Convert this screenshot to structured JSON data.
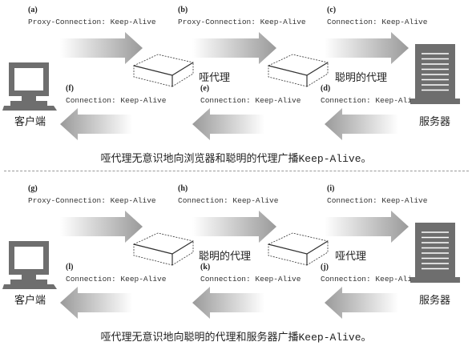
{
  "divider": "dashed",
  "colors": {
    "arrow_dark": "#9a9a9a",
    "arrow_light": "#ffffff",
    "device": "#6e6e6e"
  },
  "panels": [
    {
      "forward": [
        {
          "label": "(a)",
          "header": "Proxy-Connection: Keep-Alive"
        },
        {
          "label": "(b)",
          "header": "Proxy-Connection: Keep-Alive"
        },
        {
          "label": "(c)",
          "header": "Connection: Keep-Alive"
        }
      ],
      "backward": [
        {
          "label": "(f)",
          "header": "Connection: Keep-Alive"
        },
        {
          "label": "(e)",
          "header": "Connection: Keep-Alive"
        },
        {
          "label": "(d)",
          "header": "Connection: Keep-Alive"
        }
      ],
      "client": "客户端",
      "proxy1": "哑代理",
      "proxy2": "聪明的代理",
      "server": "服务器",
      "caption_pre": "哑代理无意识地向浏览器和聪明的代理广播",
      "caption_mono": "Keep-Alive",
      "caption_post": "。"
    },
    {
      "forward": [
        {
          "label": "(g)",
          "header": "Proxy-Connection: Keep-Alive"
        },
        {
          "label": "(h)",
          "header": "Connection: Keep-Alive"
        },
        {
          "label": "(i)",
          "header": "Connection: Keep-Alive"
        }
      ],
      "backward": [
        {
          "label": "(l)",
          "header": "Connection: Keep-Alive"
        },
        {
          "label": "(k)",
          "header": "Connection: Keep-Alive"
        },
        {
          "label": "(j)",
          "header": "Connection: Keep-Alive"
        }
      ],
      "client": "客户端",
      "proxy1": "聪明的代理",
      "proxy2": "哑代理",
      "server": "服务器",
      "caption_pre": "哑代理无意识地向聪明的代理和服务器广播",
      "caption_mono": "Keep-Alive",
      "caption_post": "。"
    }
  ]
}
